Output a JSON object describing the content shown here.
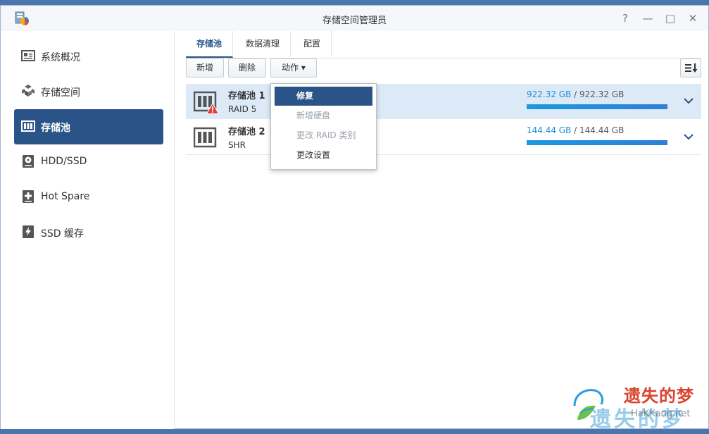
{
  "window": {
    "title": "存储空间管理员",
    "controls": {
      "help": "?",
      "minimize": "—",
      "maximize": "□",
      "close": "✕"
    }
  },
  "sidebar": {
    "items": [
      {
        "label": "系统概况",
        "icon": "overview-icon",
        "active": false
      },
      {
        "label": "存储空间",
        "icon": "cubes-icon",
        "active": false
      },
      {
        "label": "存储池",
        "icon": "storage-pool-icon",
        "active": true
      },
      {
        "label": "HDD/SSD",
        "icon": "disk-icon",
        "active": false
      },
      {
        "label": "Hot Spare",
        "icon": "plus-box-icon",
        "active": false
      },
      {
        "label": "SSD 缓存",
        "icon": "ssd-cache-icon",
        "active": false
      }
    ]
  },
  "tabs": [
    {
      "label": "存储池",
      "active": true
    },
    {
      "label": "数据清理",
      "active": false
    },
    {
      "label": "配置",
      "active": false
    }
  ],
  "toolbar": {
    "create": "新增",
    "delete": "删除",
    "action": "动作 ▾"
  },
  "pools": [
    {
      "name": "存储池 1",
      "type": "RAID 5",
      "used": "922.32 GB",
      "separator": " / ",
      "total": "922.32 GB",
      "fill_percent": 100,
      "warning": true,
      "selected": true
    },
    {
      "name": "存储池 2",
      "type": "SHR",
      "used": "144.44 GB",
      "separator": " / ",
      "total": "144.44 GB",
      "fill_percent": 100,
      "warning": false,
      "selected": false
    }
  ],
  "action_menu": {
    "items": [
      {
        "label": "修复",
        "state": "hover"
      },
      {
        "label": "新增硬盘",
        "state": "disabled"
      },
      {
        "label": "更改 RAID 类别",
        "state": "disabled"
      },
      {
        "label": "更改设置",
        "state": "normal"
      }
    ]
  },
  "watermark": {
    "line1": "遗失的梦",
    "line2": "遗失的梦",
    "site": "HaKKang.net"
  },
  "colors": {
    "accent": "#2a5487",
    "selected_row": "#dceaf8",
    "usage_text": "#1a8fd8",
    "warning": "#e23b3b"
  }
}
